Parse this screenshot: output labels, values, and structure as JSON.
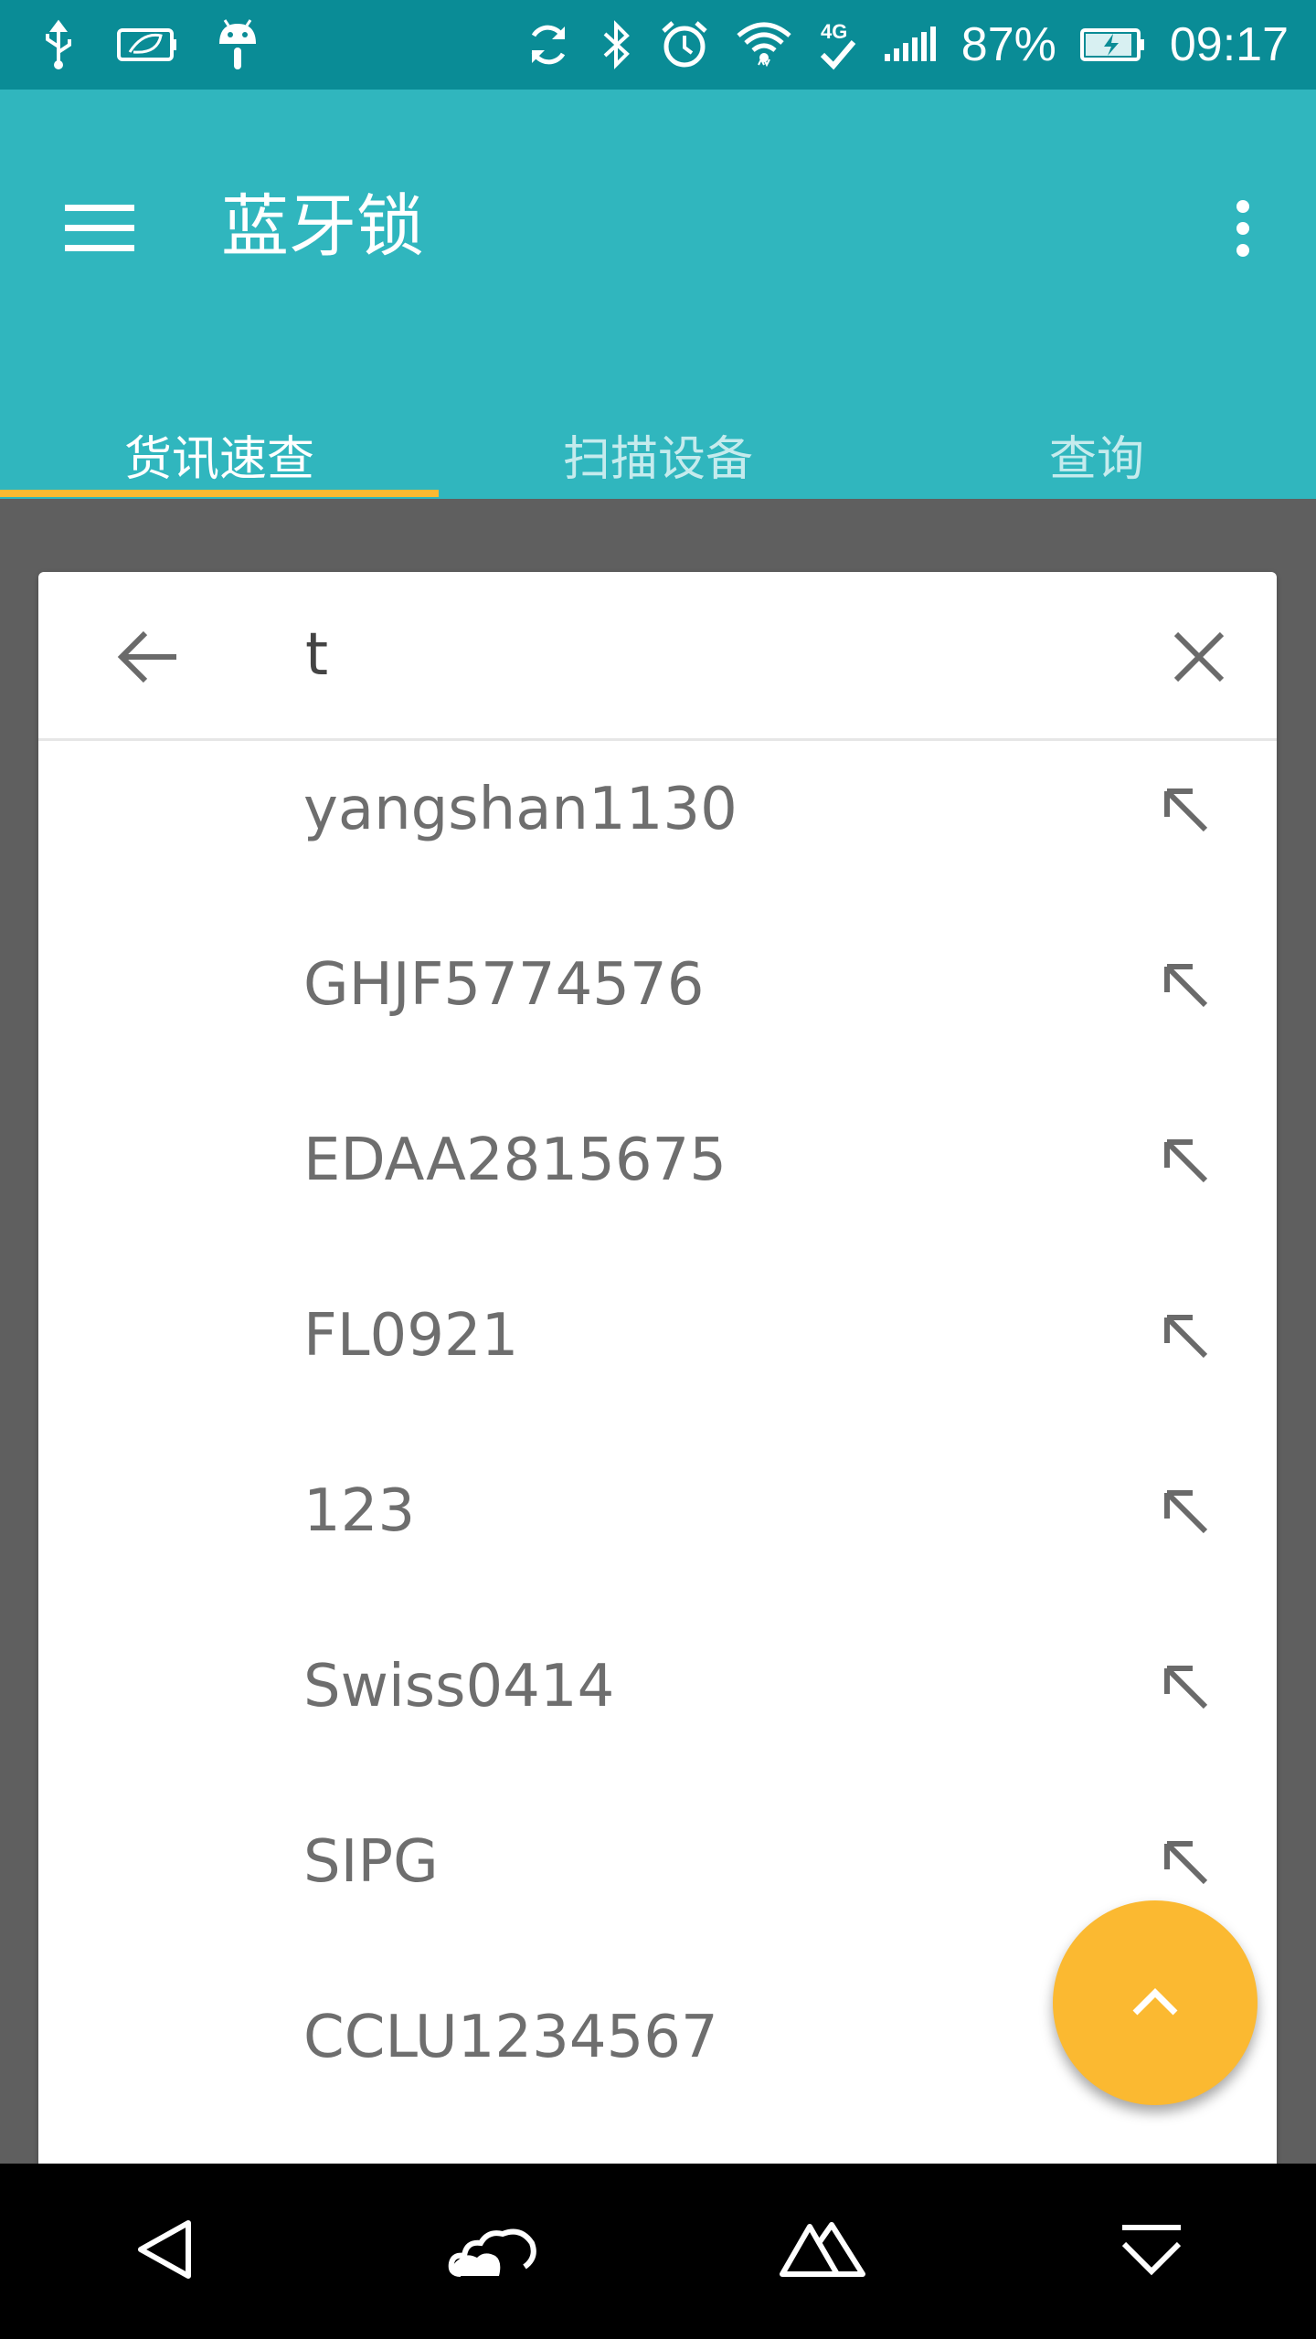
{
  "status_bar": {
    "battery_percent": "87%",
    "time": "09:17",
    "icons": [
      "usb-icon",
      "leaf-battery-icon",
      "android-icon",
      "sync-icon",
      "bluetooth-icon",
      "alarm-icon",
      "wifi-icon",
      "4g-icon",
      "signal-icon",
      "battery-charging-icon"
    ]
  },
  "app_bar": {
    "title": "蓝牙锁",
    "menu_icon": "hamburger-icon",
    "more_icon": "more-vert-icon"
  },
  "tabs": [
    {
      "label": "货讯速查",
      "active": true
    },
    {
      "label": "扫描设备",
      "active": false
    },
    {
      "label": "查询",
      "active": false
    }
  ],
  "search": {
    "value": "t",
    "back_icon": "arrow-back-icon",
    "clear_icon": "close-icon"
  },
  "suggestions": [
    {
      "text": "yangshan1130"
    },
    {
      "text": "GHJF5774576"
    },
    {
      "text": "EDAA2815675"
    },
    {
      "text": "FL0921"
    },
    {
      "text": "123"
    },
    {
      "text": "Swiss0414"
    },
    {
      "text": "SIPG"
    },
    {
      "text": "CCLU1234567"
    }
  ],
  "fab": {
    "icon": "chevron-up-icon"
  },
  "nav_bar": {
    "icons": [
      "back-triangle-icon",
      "cloud-icon",
      "mountain-icon",
      "dropdown-icon"
    ]
  },
  "colors": {
    "status_bar": "#0a8c96",
    "app_bar": "#30b6be",
    "accent": "#fbb931",
    "scrim": "#5f5f5f"
  }
}
